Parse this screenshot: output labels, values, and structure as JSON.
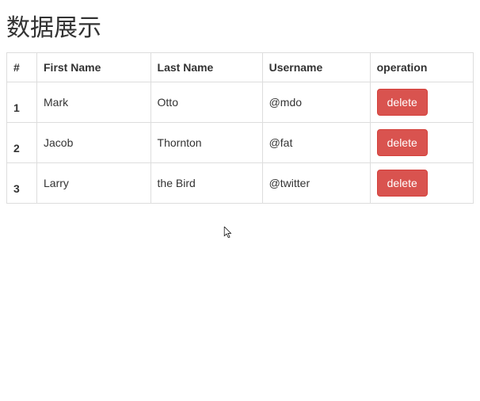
{
  "page": {
    "title": "数据展示"
  },
  "table": {
    "headers": {
      "index": "#",
      "first_name": "First Name",
      "last_name": "Last Name",
      "username": "Username",
      "operation": "operation"
    },
    "rows": [
      {
        "index": "1",
        "first_name": "Mark",
        "last_name": "Otto",
        "username": "@mdo",
        "delete_label": "delete"
      },
      {
        "index": "2",
        "first_name": "Jacob",
        "last_name": "Thornton",
        "username": "@fat",
        "delete_label": "delete"
      },
      {
        "index": "3",
        "first_name": "Larry",
        "last_name": "the Bird",
        "username": "@twitter",
        "delete_label": "delete"
      }
    ]
  },
  "colors": {
    "danger": "#d9534f"
  }
}
